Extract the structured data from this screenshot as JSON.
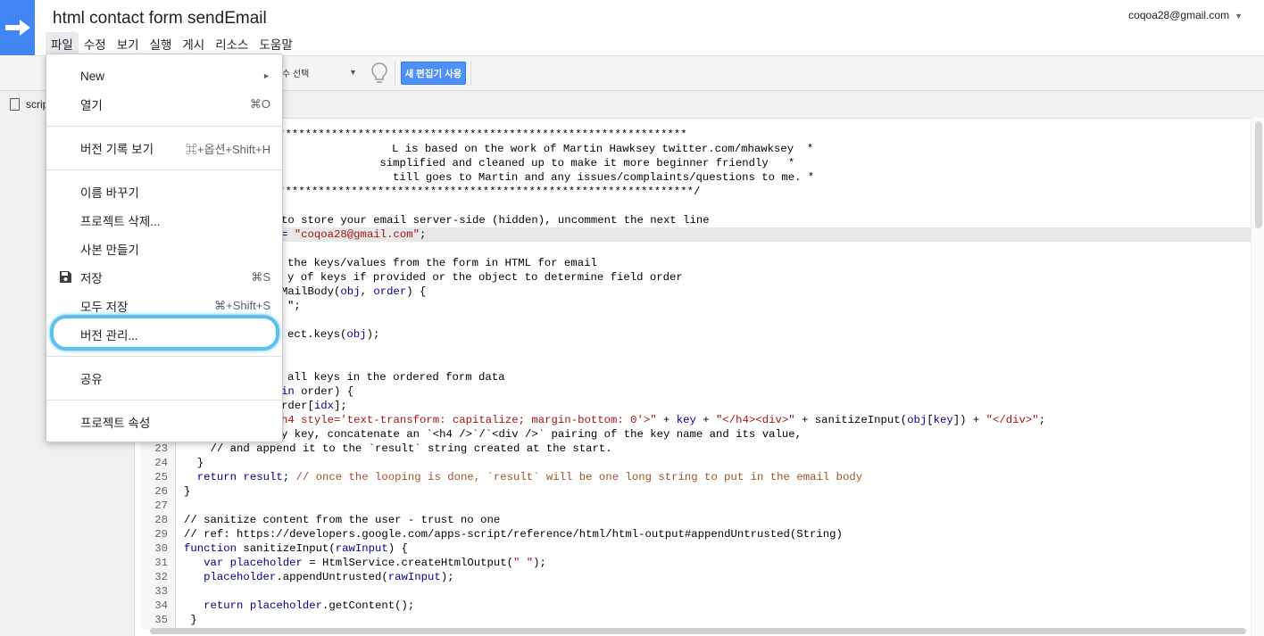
{
  "app": {
    "title": "html contact form sendEmail",
    "account": "coqoa28@gmail.com"
  },
  "menubar": [
    "파일",
    "수정",
    "보기",
    "실행",
    "게시",
    "리소스",
    "도움말"
  ],
  "toolbar": {
    "function_select": "수 선택",
    "new_editor_button": "새 편집기 사용"
  },
  "file_tab": "scrip",
  "file_menu": {
    "items": [
      {
        "label": "New",
        "shortcut": ""
      },
      {
        "label": "열기",
        "shortcut": "⌘O"
      },
      {
        "label": "버전 기록 보기",
        "shortcut": "⌘+옵션+Shift+H"
      },
      {
        "label": "이름 바꾸기",
        "shortcut": ""
      },
      {
        "label": "프로젝트 삭제...",
        "shortcut": ""
      },
      {
        "label": "사본 만들기",
        "shortcut": ""
      },
      {
        "label": "저장",
        "shortcut": "⌘S"
      },
      {
        "label": "모두 저장",
        "shortcut": "⌘+Shift+S"
      },
      {
        "label": "버전 관리...",
        "shortcut": ""
      },
      {
        "label": "공유",
        "shortcut": ""
      },
      {
        "label": "프로젝트 속성",
        "shortcut": ""
      }
    ],
    "new_arrow": "►"
  },
  "code": {
    "line_numbers": [
      "23",
      "24",
      "25",
      "26",
      "27",
      "28",
      "29",
      "30",
      "31",
      "32",
      "33",
      "34",
      "35"
    ],
    "hidden_lines": [
      "*****************************************************************",
      "L is based on the work of Martin Hawksey twitter.com/mhawksey  *",
      " simplified and cleaned up to make it more beginner friendly   *",
      "till goes to Martin and any issues/complaints/questions to me. *",
      "******************************************************************/",
      "",
      "to store your email server-side (hidden), uncomment the next line",
      "",
      "",
      "the keys/values from the form in HTML for email",
      "y of keys if provided or the object to determine field order",
      "MailBody(",
      "\";",
      "",
      "ect.keys(",
      "",
      "",
      "all keys in the ordered form data",
      "in order) {",
      "rder[idx];",
      "h4 style='text-transform: capitalize; margin-bottom: 0'>\" + key + \"</h4><div>\" + sanitizeInput(obj[key]) + \"</div>\";",
      "y key, concatenate an `<h4 />`/`<div />` pairing of the key name and its value,"
    ],
    "line_18": "= \"coqoa28@gmail.com\";",
    "line_22_obj": "obj",
    "line_22_order": "order",
    "visible_lines": [
      "    // and append it to the `result` string created at the start.",
      "  }",
      "  return result; // once the looping is done, `result` will be one long string to put in the email body",
      "}",
      "",
      "// sanitize content from the user - trust no one",
      "// ref: https://developers.google.com/apps-script/reference/html/html-output#appendUntrusted(String)",
      "function sanitizeInput(rawInput) {",
      "   var placeholder = HtmlService.createHtmlOutput(\" \");",
      "   placeholder.appendUntrusted(rawInput);",
      "",
      "   return placeholder.getContent();",
      " }"
    ]
  },
  "colors": {
    "brand": "#4285f4",
    "new_editor_button": "#4d90fe",
    "highlight_ring": "#5bc0eb",
    "comment": "#a0522d",
    "keyword": "#000080",
    "string": "#a31515"
  }
}
